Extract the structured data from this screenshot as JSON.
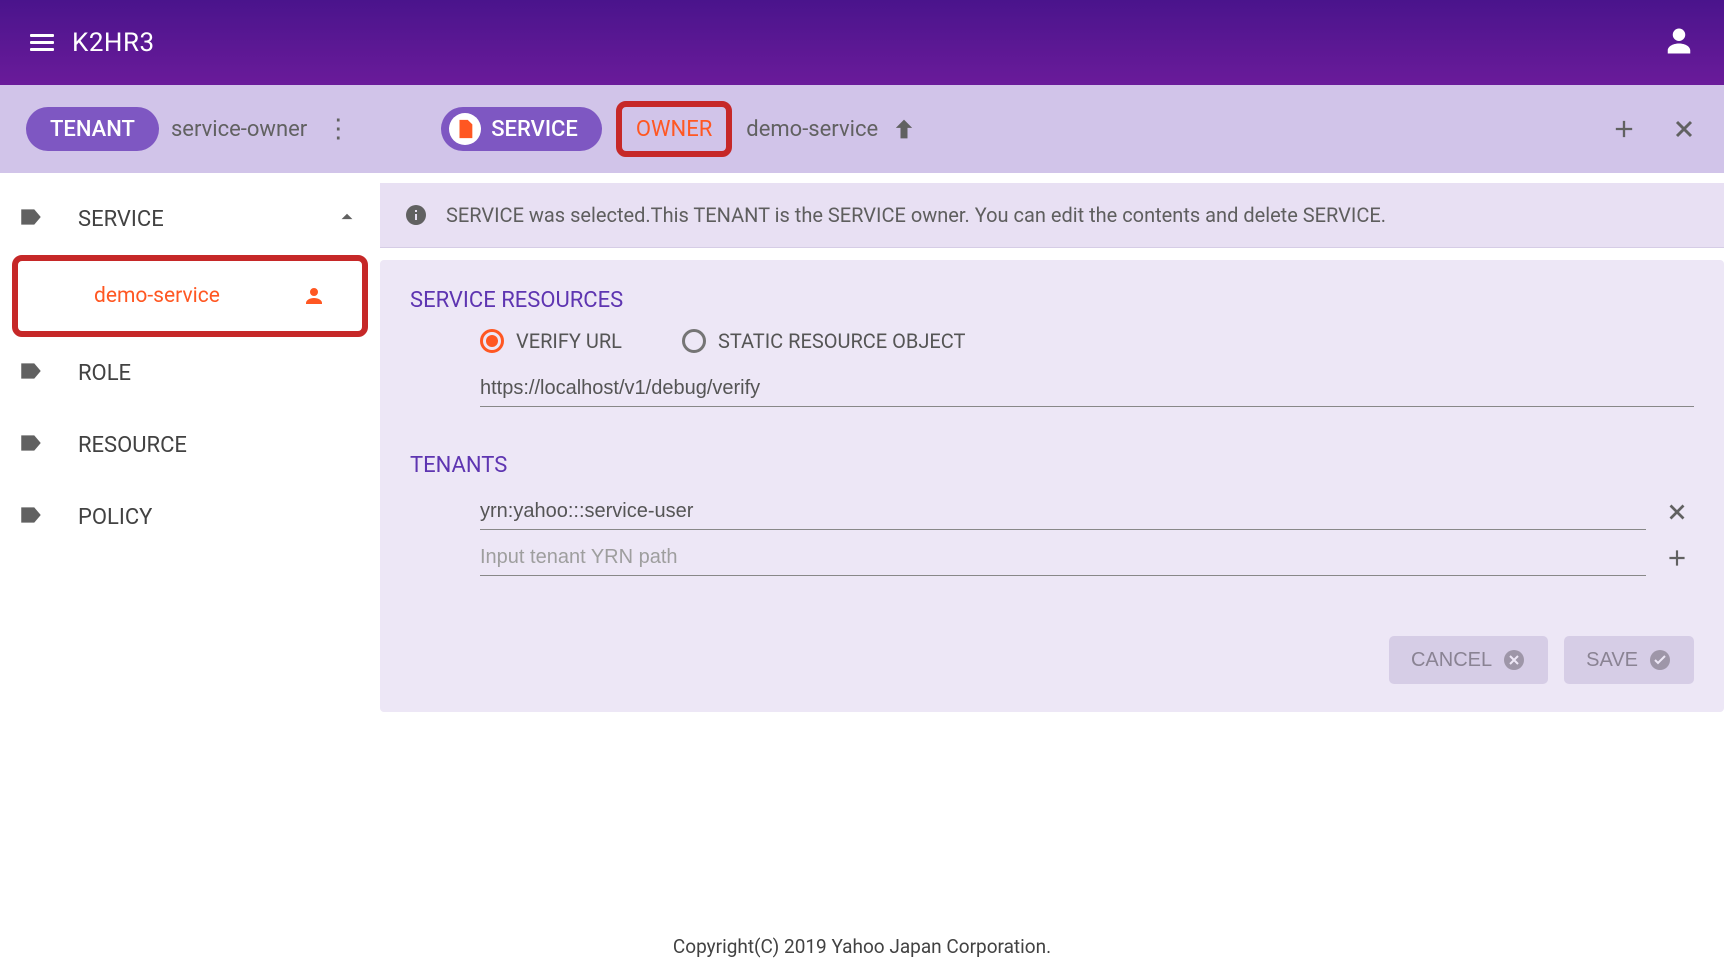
{
  "header": {
    "title": "K2HR3"
  },
  "breadcrumb": {
    "tenant_label": "TENANT",
    "tenant_value": "service-owner",
    "service_label": "SERVICE",
    "owner_label": "OWNER",
    "service_value": "demo-service"
  },
  "sidebar": {
    "service": "SERVICE",
    "sub_service": "demo-service",
    "role": "ROLE",
    "resource": "RESOURCE",
    "policy": "POLICY"
  },
  "info": "SERVICE was selected.This TENANT is the SERVICE owner. You can edit the contents and delete SERVICE.",
  "resources": {
    "title": "SERVICE RESOURCES",
    "radio_verify": "VERIFY URL",
    "radio_static": "STATIC RESOURCE OBJECT",
    "url_value": "https://localhost/v1/debug/verify"
  },
  "tenants": {
    "title": "TENANTS",
    "row1_value": "yrn:yahoo:::service-user",
    "row2_placeholder": "Input tenant YRN path"
  },
  "buttons": {
    "cancel": "CANCEL",
    "save": "SAVE"
  },
  "footer": "Copyright(C) 2019 Yahoo Japan Corporation."
}
